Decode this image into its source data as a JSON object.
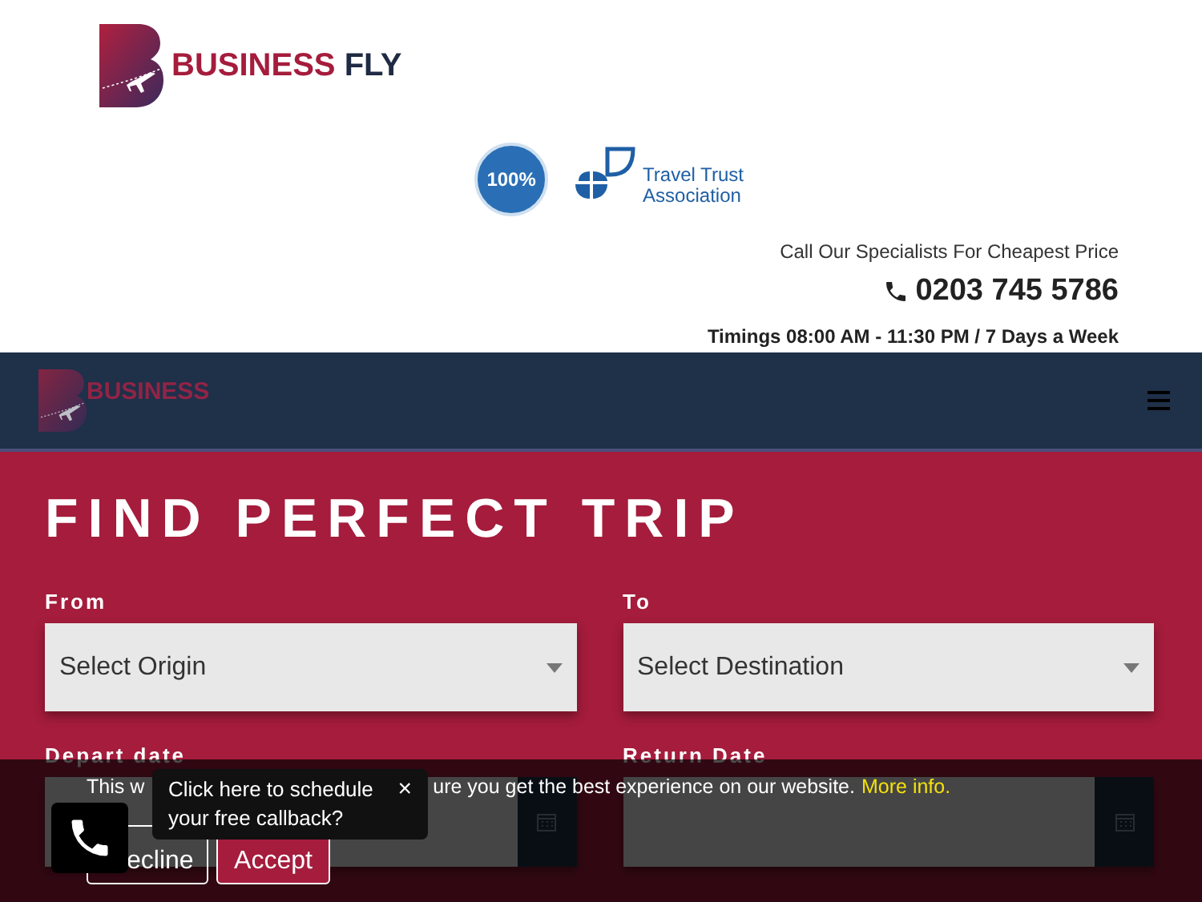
{
  "header": {
    "logo": {
      "brand_primary": "BUSINESS",
      "brand_secondary": "FLY"
    },
    "badges": {
      "protection": "100%",
      "association_line_1": "Travel Trust",
      "association_line_2": "Association"
    },
    "tagline": "Call Our Specialists For Cheapest Price",
    "phone": "0203 745 5786",
    "timings": "Timings 08:00 AM - 11:30 PM / 7 Days a Week"
  },
  "navbar": {
    "logo_text": "BUSINESS"
  },
  "search": {
    "title": "FIND PERFECT TRIP",
    "fields": [
      {
        "kind": "select",
        "label": "From",
        "value": "Select Origin"
      },
      {
        "kind": "select",
        "label": "To",
        "value": "Select Destination"
      },
      {
        "kind": "date",
        "label": "Depart date"
      },
      {
        "kind": "date",
        "label": "Return Date"
      }
    ]
  },
  "cookie_banner": {
    "text_start": "This w",
    "text_end": "ure you get the best experience on our website.",
    "link": "More info.",
    "decline": "ecline",
    "accept": "Accept"
  },
  "callback": {
    "tooltip": "Click here to schedule your free callback?",
    "close": "×"
  }
}
